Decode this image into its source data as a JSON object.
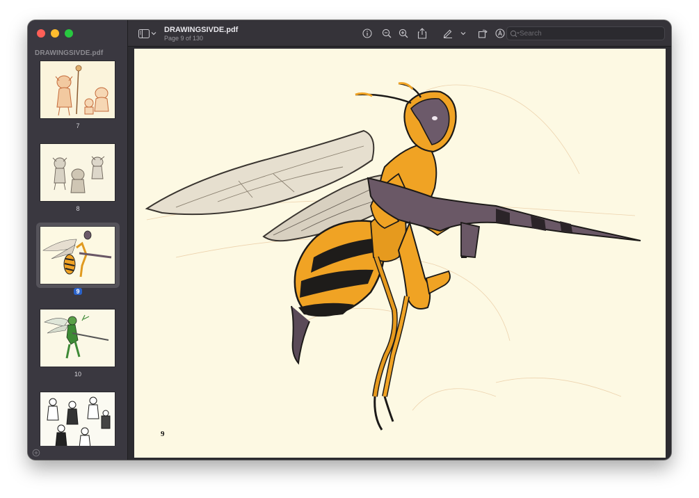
{
  "window": {
    "title": "DRAWINGSIVDE.pdf",
    "subtitle": "Page 9 of 130"
  },
  "sidebar": {
    "document_name": "DRAWINGSIVDE.pdf",
    "thumbnails": [
      {
        "label": "7",
        "selected": false
      },
      {
        "label": "8",
        "selected": false
      },
      {
        "label": "9",
        "selected": true
      },
      {
        "label": "10",
        "selected": false
      },
      {
        "label": "",
        "selected": false
      }
    ]
  },
  "toolbar": {
    "icons": [
      "sidebar-toggle-icon",
      "chevron-down-icon",
      "info-icon",
      "zoom-out-icon",
      "zoom-in-icon",
      "share-icon",
      "markup-pen-icon",
      "chevron-down-icon",
      "rotate-icon",
      "annotate-icon",
      "signature-icon",
      "search-icon"
    ]
  },
  "search": {
    "placeholder": "Search",
    "value": ""
  },
  "page": {
    "page_number_label": "9"
  },
  "colors": {
    "accent": "#2a62c9",
    "traffic_red": "#fe5f57",
    "traffic_yellow": "#febc2e",
    "traffic_green": "#28c840",
    "page_bg": "#fdf9e3",
    "wasp_orange": "#f0a324"
  }
}
